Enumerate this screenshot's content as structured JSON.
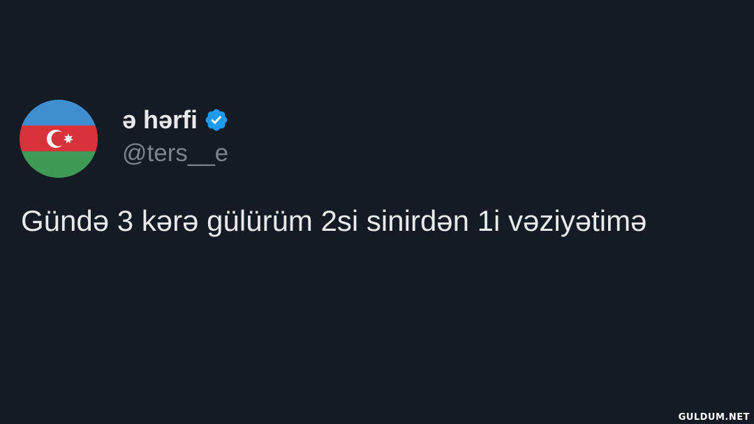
{
  "tweet": {
    "author": {
      "display_name": "ə hərfi",
      "handle": "@ters__e",
      "avatar_icon": "azerbaijan-flag-icon",
      "verified_icon": "verified-badge-icon"
    },
    "text": "Gündə 3 kərə gülürüm 2si sinirdən 1i vəziyətimə"
  },
  "watermark": "GULDUM.NET",
  "colors": {
    "background": "#151b24",
    "text_primary": "#e7e9ea",
    "text_secondary": "#7b848d",
    "verified": "#1d9bf0",
    "flag_blue": "#3f8fd0",
    "flag_red": "#d8323b",
    "flag_green": "#3e9a55"
  }
}
